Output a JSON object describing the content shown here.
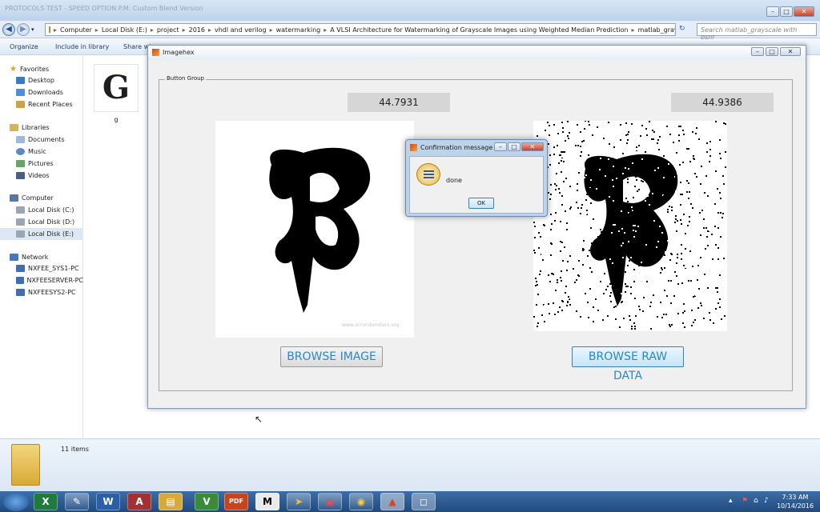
{
  "explorer": {
    "title_text": "PROTOCOLS  TEST  - SPEED OPTION P.M.  Custom Blend Version",
    "breadcrumb": [
      "Computer",
      "Local Disk (E:)",
      "project",
      "2016",
      "vhdl and verilog",
      "watermarking",
      "A VLSI Architecture for Watermarking of Grayscale Images using Weighted Median Prediction",
      "matlab_grayscale with psnr"
    ],
    "search_placeholder": "Search matlab_grayscale with psnr",
    "toolbar": {
      "organize": "Organize",
      "include": "Include in library",
      "share": "Share wi"
    },
    "nav": {
      "favorites": "Favorites",
      "fav_items": [
        "Desktop",
        "Downloads",
        "Recent Places"
      ],
      "libraries": "Libraries",
      "lib_items": [
        "Documents",
        "Music",
        "Pictures",
        "Videos"
      ],
      "computer": "Computer",
      "comp_items": [
        "Local Disk (C:)",
        "Local Disk (D:)",
        "Local Disk (E:)"
      ],
      "network": "Network",
      "net_items": [
        "NXFEE_SYS1-PC",
        "NXFEESERVER-PC",
        "NXFEESYS2-PC"
      ]
    },
    "file": {
      "glyph": "G",
      "name": "g"
    },
    "status": {
      "count": "11 items"
    }
  },
  "figure": {
    "title": "Imagehex",
    "group_label": "Button Group",
    "psnr_left": "44.7931",
    "psnr_right": "44.9386",
    "browse_image": "BROWSE IMAGE",
    "browse_raw": "BROWSE RAW DATA",
    "watermark_text": "www.acrondomiters.org"
  },
  "dialog": {
    "title": "Confirmation message",
    "message": "done",
    "ok": "OK"
  },
  "taskbar": {
    "time": "7:33 AM",
    "date": "10/14/2016",
    "apps": [
      "excel-icon",
      "paint-icon",
      "word-icon",
      "access-icon",
      "explorer-icon",
      "vim-icon",
      "pdf-icon",
      "matlab-m-icon",
      "arrow-icon",
      "device-icon",
      "chrome-icon",
      "matlab-icon",
      "window-icon"
    ]
  },
  "colors": {
    "accent_link": "#2e86c1",
    "taskbar": "#2b5a91"
  }
}
